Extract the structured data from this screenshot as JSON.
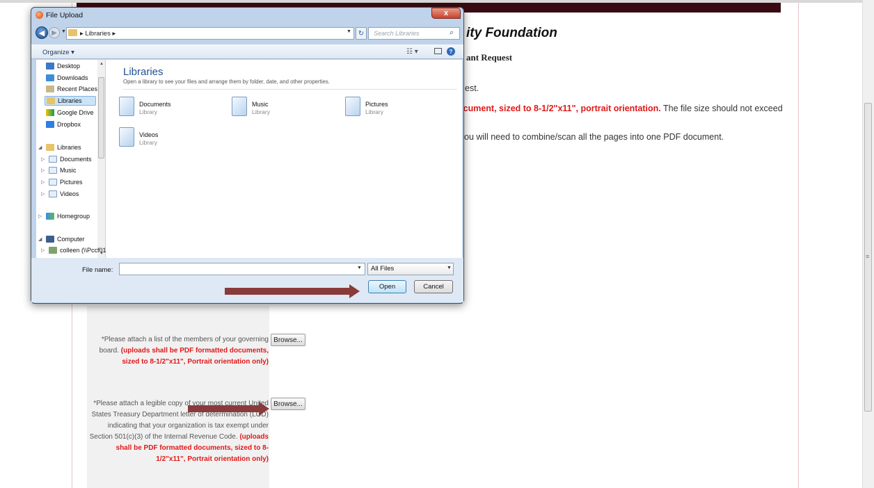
{
  "page": {
    "title": "ity Foundation",
    "subtitle": "ant Request",
    "para1": "est.",
    "para2_red": "ocument, sized to 8-1/2\"x11\", portrait orientation.",
    "para2_rest": " The file size should not exceed",
    "para3": "ou will need to combine/scan all the pages into one PDF document.",
    "field1": {
      "label": "*Please attach a list of the members of your governing board.",
      "note": "(uploads shall be PDF formatted documents, sized to 8-1/2\"x11\", Portrait orientation only)",
      "button": "Browse..."
    },
    "field2": {
      "label": "*Please attach a legible copy of your most current United States Treasury Department letter of determination (LOD) indicating that your organization is tax exempt under Section 501(c)(3) of the Internal Revenue Code.",
      "note": "(uploads shall be PDF formatted documents, sized to 8-1/2\"x11\", Portrait orientation only)",
      "button": "Browse..."
    }
  },
  "dialog": {
    "title": "File Upload",
    "close": "x",
    "address": "▸ Libraries ▸",
    "search_placeholder": "Search Libraries",
    "organize": "Organize ▾",
    "nav": {
      "favorites": [
        "Desktop",
        "Downloads",
        "Recent Places",
        "Libraries",
        "Google Drive",
        "Dropbox"
      ],
      "libraries_header": "Libraries",
      "libraries": [
        "Documents",
        "Music",
        "Pictures",
        "Videos"
      ],
      "homegroup": "Homegroup",
      "computer": "Computer",
      "computer_child": "colleen (\\\\Pccf01"
    },
    "content": {
      "heading": "Libraries",
      "description": "Open a library to see your files and arrange them by folder, date, and other properties.",
      "items": [
        {
          "name": "Documents",
          "type": "Library"
        },
        {
          "name": "Music",
          "type": "Library"
        },
        {
          "name": "Pictures",
          "type": "Library"
        },
        {
          "name": "Videos",
          "type": "Library"
        }
      ]
    },
    "filename_label": "File name:",
    "filename_value": "",
    "filter": "All Files",
    "open": "Open",
    "cancel": "Cancel"
  },
  "colors": {
    "maroon": "#3a0a12",
    "red_text": "#e01818",
    "arrow": "#8a3a3a",
    "dialog_frame": "#bfd3ea"
  }
}
